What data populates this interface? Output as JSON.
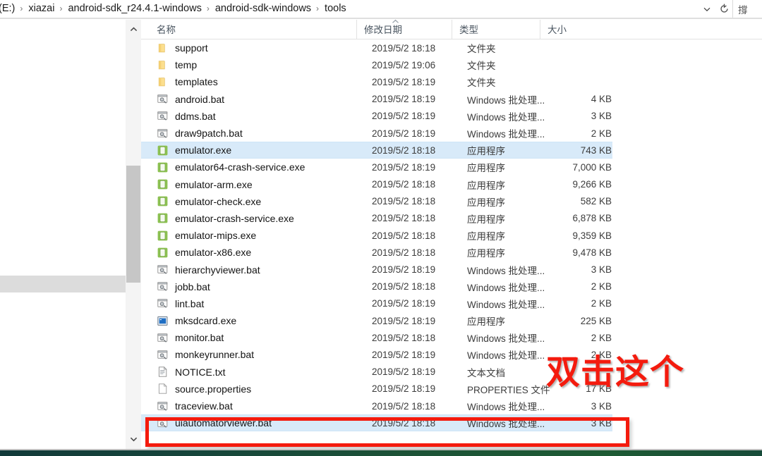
{
  "window": {
    "type": "file-explorer",
    "accent_selection": "#d8eaf9",
    "annotation_color": "#f41b0e"
  },
  "addressbar": {
    "breadcrumb": [
      {
        "label": "(E:)"
      },
      {
        "label": "xiazai"
      },
      {
        "label": "android-sdk_r24.4.1-windows"
      },
      {
        "label": "android-sdk-windows"
      },
      {
        "label": "tools"
      }
    ],
    "separator": "›",
    "history_dropdown_icon": "chevron-down-icon",
    "refresh_icon": "refresh-icon",
    "search_placeholder": "撐"
  },
  "navpane": {
    "items": []
  },
  "scrollbar": {
    "up_icon": "chevron-up-icon",
    "down_icon": "chevron-down-icon"
  },
  "filelist": {
    "columns": [
      {
        "key": "name",
        "label": "名称"
      },
      {
        "key": "date",
        "label": "修改日期"
      },
      {
        "key": "type",
        "label": "类型"
      },
      {
        "key": "size",
        "label": "大小"
      }
    ],
    "sort": {
      "column": "name",
      "direction": "ascending",
      "icon": "caret-up-icon"
    },
    "rows": [
      {
        "name": "support",
        "date": "2019/5/2 18:18",
        "type": "文件夹",
        "size": "",
        "icon": "folder-icon",
        "selected": false
      },
      {
        "name": "temp",
        "date": "2019/5/2 19:06",
        "type": "文件夹",
        "size": "",
        "icon": "folder-icon",
        "selected": false
      },
      {
        "name": "templates",
        "date": "2019/5/2 18:19",
        "type": "文件夹",
        "size": "",
        "icon": "folder-icon",
        "selected": false
      },
      {
        "name": "android.bat",
        "date": "2019/5/2 18:19",
        "type": "Windows 批处理...",
        "size": "4 KB",
        "icon": "bat-script-icon",
        "selected": false
      },
      {
        "name": "ddms.bat",
        "date": "2019/5/2 18:19",
        "type": "Windows 批处理...",
        "size": "3 KB",
        "icon": "bat-script-icon",
        "selected": false
      },
      {
        "name": "draw9patch.bat",
        "date": "2019/5/2 18:19",
        "type": "Windows 批处理...",
        "size": "2 KB",
        "icon": "bat-script-icon",
        "selected": false
      },
      {
        "name": "emulator.exe",
        "date": "2019/5/2 18:18",
        "type": "应用程序",
        "size": "743 KB",
        "icon": "emulator-app-icon",
        "selected": true
      },
      {
        "name": "emulator64-crash-service.exe",
        "date": "2019/5/2 18:19",
        "type": "应用程序",
        "size": "7,000 KB",
        "icon": "emulator-app-icon",
        "selected": false
      },
      {
        "name": "emulator-arm.exe",
        "date": "2019/5/2 18:18",
        "type": "应用程序",
        "size": "9,266 KB",
        "icon": "emulator-app-icon",
        "selected": false
      },
      {
        "name": "emulator-check.exe",
        "date": "2019/5/2 18:18",
        "type": "应用程序",
        "size": "582 KB",
        "icon": "emulator-app-icon",
        "selected": false
      },
      {
        "name": "emulator-crash-service.exe",
        "date": "2019/5/2 18:18",
        "type": "应用程序",
        "size": "6,878 KB",
        "icon": "emulator-app-icon",
        "selected": false
      },
      {
        "name": "emulator-mips.exe",
        "date": "2019/5/2 18:18",
        "type": "应用程序",
        "size": "9,359 KB",
        "icon": "emulator-app-icon",
        "selected": false
      },
      {
        "name": "emulator-x86.exe",
        "date": "2019/5/2 18:18",
        "type": "应用程序",
        "size": "9,478 KB",
        "icon": "emulator-app-icon",
        "selected": false
      },
      {
        "name": "hierarchyviewer.bat",
        "date": "2019/5/2 18:19",
        "type": "Windows 批处理...",
        "size": "3 KB",
        "icon": "bat-script-icon",
        "selected": false
      },
      {
        "name": "jobb.bat",
        "date": "2019/5/2 18:18",
        "type": "Windows 批处理...",
        "size": "2 KB",
        "icon": "bat-script-icon",
        "selected": false
      },
      {
        "name": "lint.bat",
        "date": "2019/5/2 18:19",
        "type": "Windows 批处理...",
        "size": "2 KB",
        "icon": "bat-script-icon",
        "selected": false
      },
      {
        "name": "mksdcard.exe",
        "date": "2019/5/2 18:19",
        "type": "应用程序",
        "size": "225 KB",
        "icon": "console-app-icon",
        "selected": false
      },
      {
        "name": "monitor.bat",
        "date": "2019/5/2 18:18",
        "type": "Windows 批处理...",
        "size": "2 KB",
        "icon": "bat-script-icon",
        "selected": false
      },
      {
        "name": "monkeyrunner.bat",
        "date": "2019/5/2 18:19",
        "type": "Windows 批处理...",
        "size": "2 KB",
        "icon": "bat-script-icon",
        "selected": false
      },
      {
        "name": "NOTICE.txt",
        "date": "2019/5/2 18:19",
        "type": "文本文档",
        "size": "",
        "icon": "text-document-icon",
        "selected": false
      },
      {
        "name": "source.properties",
        "date": "2019/5/2 18:19",
        "type": "PROPERTIES 文件",
        "size": "17 KB",
        "icon": "blank-document-icon",
        "selected": false
      },
      {
        "name": "traceview.bat",
        "date": "2019/5/2 18:18",
        "type": "Windows 批处理...",
        "size": "3 KB",
        "icon": "bat-script-icon",
        "selected": false
      },
      {
        "name": "uiautomatorviewer.bat",
        "date": "2019/5/2 18:18",
        "type": "Windows 批处理...",
        "size": "3 KB",
        "icon": "bat-script-icon",
        "selected": true
      }
    ]
  },
  "annotation": {
    "text": "双击这个",
    "highlight_target": "uiautomatorviewer.bat"
  }
}
